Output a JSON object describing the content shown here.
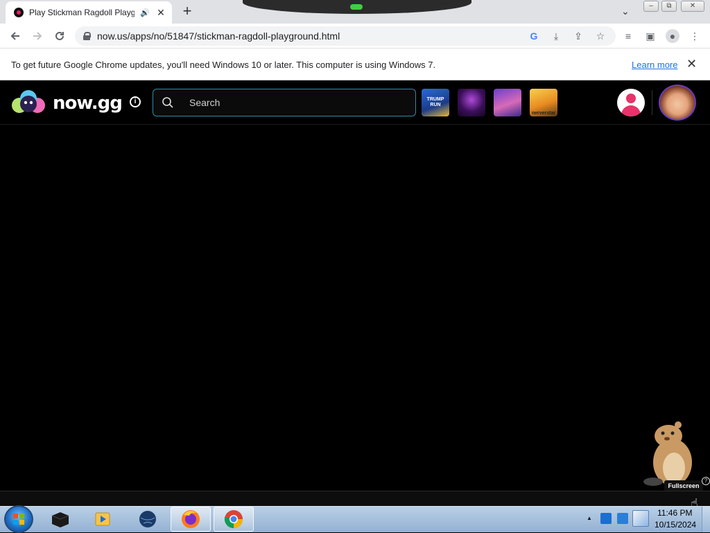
{
  "browser": {
    "tab": {
      "title": "Play Stickman Ragdoll Playground",
      "close": "✕"
    },
    "new_tab": "+",
    "tab_menu": "⌄",
    "window_buttons": {
      "minimize": "‒",
      "maximize": "⧉",
      "close": "✕"
    },
    "url": "now.us/apps/no/51847/stickman-ragdoll-playground.html"
  },
  "infobar": {
    "message": "To get future Google Chrome updates, you'll need Windows 10 or later. This computer is using Windows 7.",
    "learn_more": "Learn more",
    "close": "✕"
  },
  "site": {
    "logo_text": "now.gg",
    "info_glyph": "i",
    "search_placeholder": "Search",
    "thumbnails": [
      {
        "label": "TRUMP RUN"
      },
      {
        "label": ""
      },
      {
        "label": ""
      },
      {
        "label": "nerverstar"
      }
    ]
  },
  "game": {
    "fullscreen_tip": "Fullscreen",
    "help_glyph": "?"
  },
  "taskbar": {
    "time": "11:46 PM",
    "date": "10/15/2024",
    "tray_arrow": "▲"
  },
  "colors": {
    "accent_search_border": "#2b8fa8",
    "link": "#1a73e8",
    "user_pink": "#e8336b",
    "taskbar": "#a6c0dc"
  }
}
